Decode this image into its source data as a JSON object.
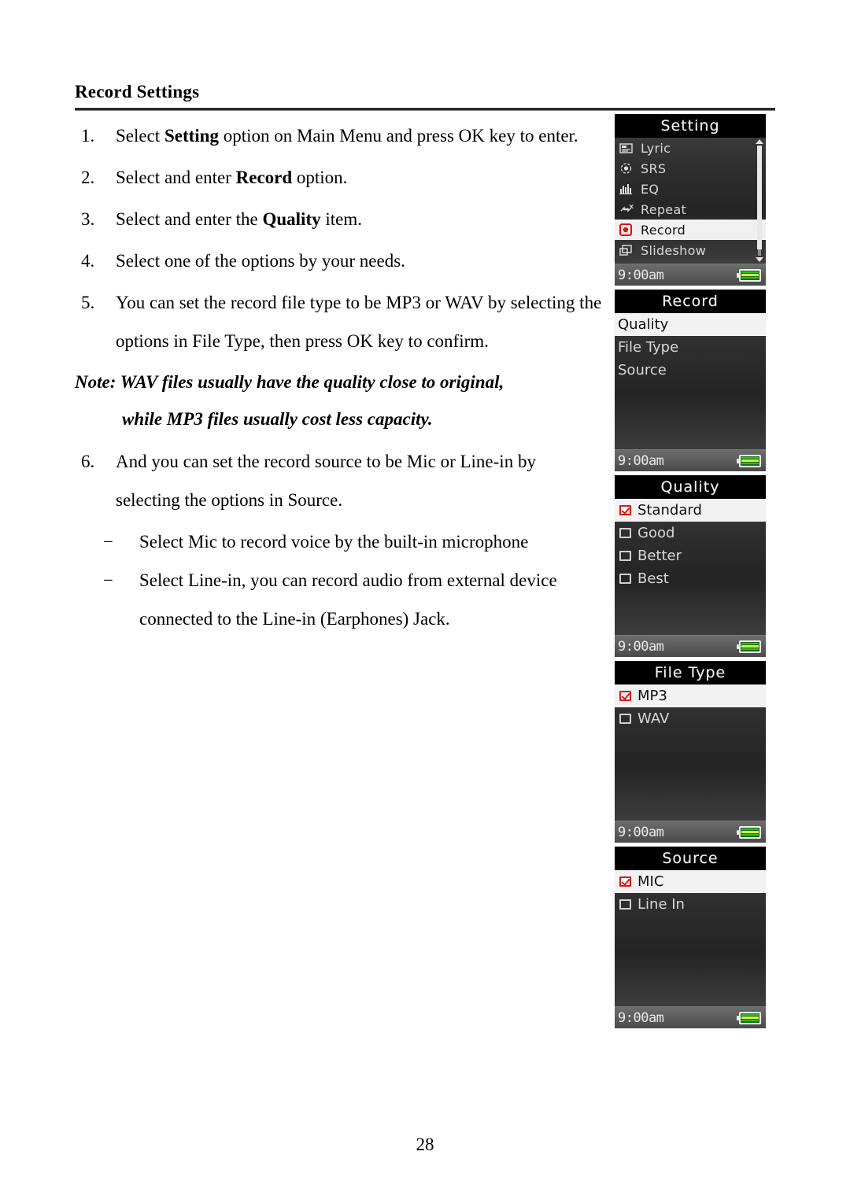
{
  "document": {
    "heading": "Record Settings",
    "page_number": "28"
  },
  "steps": [
    {
      "number": "1.",
      "parts": [
        {
          "text": "Select ",
          "bold": false
        },
        {
          "text": "Setting",
          "bold": true
        },
        {
          "text": " option on Main Menu and press OK key to enter.",
          "bold": false
        }
      ]
    },
    {
      "number": "2.",
      "parts": [
        {
          "text": "Select and enter ",
          "bold": false
        },
        {
          "text": "Record",
          "bold": true
        },
        {
          "text": " option.",
          "bold": false
        }
      ]
    },
    {
      "number": "3.",
      "parts": [
        {
          "text": "Select and enter the ",
          "bold": false
        },
        {
          "text": "Quality",
          "bold": true
        },
        {
          "text": " item.",
          "bold": false
        }
      ]
    },
    {
      "number": "4.",
      "parts": [
        {
          "text": "Select one of the options by your needs.",
          "bold": false
        }
      ]
    },
    {
      "number": "5.",
      "parts": [
        {
          "text": "You can set the record file type to be MP3 or WAV by selecting the options in File Type, then press OK key to confirm.",
          "bold": false
        }
      ]
    }
  ],
  "note": {
    "line1": "Note: WAV files usually have the quality close to original,",
    "line2": "while MP3 files usually cost less capacity."
  },
  "step6": {
    "number": "6.",
    "text": "And you can set the record source to be Mic or Line-in by selecting the options in Source.",
    "sub_items": [
      {
        "mark": "−",
        "text": "Select Mic to record voice by the built-in microphone"
      },
      {
        "mark": "−",
        "text": "Select Line-in, you can record audio from external device connected to the Line-in (Earphones) Jack."
      }
    ]
  },
  "device_screens": [
    {
      "title": "Setting",
      "type": "icon-menu",
      "has_scrollbar": true,
      "items": [
        {
          "label": "Lyric",
          "icon": "lyric-icon",
          "selected": false
        },
        {
          "label": "SRS",
          "icon": "srs-icon",
          "selected": false
        },
        {
          "label": "EQ",
          "icon": "eq-icon",
          "selected": false
        },
        {
          "label": "Repeat",
          "icon": "repeat-icon",
          "selected": false
        },
        {
          "label": "Record",
          "icon": "record-icon",
          "selected": true
        },
        {
          "label": "Slideshow",
          "icon": "slideshow-icon",
          "selected": false
        }
      ],
      "status": {
        "time": "9:00am",
        "battery": "battery-full-icon"
      }
    },
    {
      "title": "Record",
      "type": "plain-menu",
      "has_scrollbar": false,
      "items": [
        {
          "label": "Quality",
          "selected": true
        },
        {
          "label": "File Type",
          "selected": false
        },
        {
          "label": "Source",
          "selected": false
        }
      ],
      "status": {
        "time": "9:00am",
        "battery": "battery-full-icon"
      }
    },
    {
      "title": "Quality",
      "type": "checkbox-list",
      "has_scrollbar": false,
      "items": [
        {
          "label": "Standard",
          "checked": true,
          "selected": true
        },
        {
          "label": "Good",
          "checked": false,
          "selected": false
        },
        {
          "label": "Better",
          "checked": false,
          "selected": false
        },
        {
          "label": "Best",
          "checked": false,
          "selected": false
        }
      ],
      "status": {
        "time": "9:00am",
        "battery": "battery-full-icon"
      }
    },
    {
      "title": "File Type",
      "type": "checkbox-list",
      "has_scrollbar": false,
      "items": [
        {
          "label": "MP3",
          "checked": true,
          "selected": true
        },
        {
          "label": "WAV",
          "checked": false,
          "selected": false
        }
      ],
      "status": {
        "time": "9:00am",
        "battery": "battery-full-icon"
      }
    },
    {
      "title": "Source",
      "type": "checkbox-list",
      "has_scrollbar": false,
      "items": [
        {
          "label": "MIC",
          "checked": true,
          "selected": true
        },
        {
          "label": "Line In",
          "checked": false,
          "selected": false
        }
      ],
      "status": {
        "time": "9:00am",
        "battery": "battery-full-icon"
      }
    }
  ],
  "colors": {
    "checked_box": "#d81818",
    "selection_bg": "#f2f2f2",
    "screen_bg": "#2e2e2e",
    "title_bg": "#000000",
    "battery_green": "#27c021"
  }
}
